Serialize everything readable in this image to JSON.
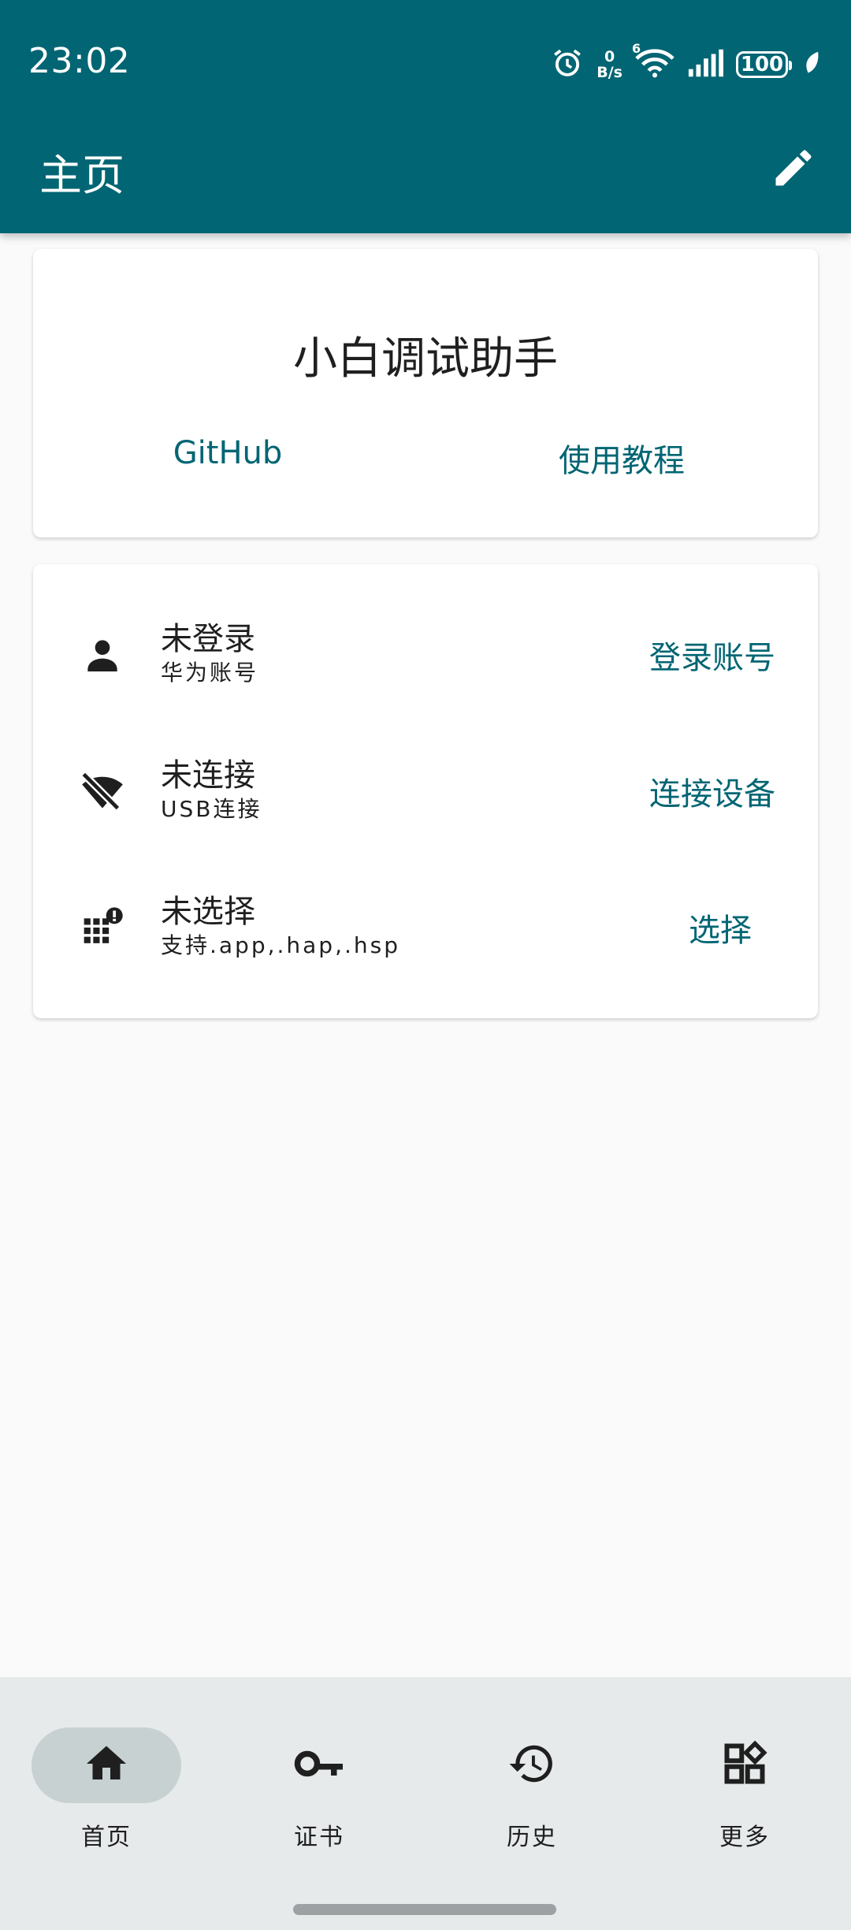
{
  "status_bar": {
    "time": "23:02",
    "net_speed_value": "0",
    "net_speed_unit": "B/s",
    "wifi_label": "6",
    "battery": "100",
    "icons": [
      "alarm-icon",
      "wifi-icon",
      "signal-icon",
      "battery-icon",
      "leaf-icon"
    ]
  },
  "app_bar": {
    "title": "主页",
    "action_icon": "edit-icon"
  },
  "hero_card": {
    "title": "小白调试助手",
    "links": [
      "GitHub",
      "使用教程"
    ]
  },
  "status_card": {
    "rows": [
      {
        "icon": "person-icon",
        "title": "未登录",
        "subtitle": "华为账号",
        "action": "登录账号"
      },
      {
        "icon": "wifi-off-icon",
        "title": "未连接",
        "subtitle": "USB连接",
        "action": "连接设备"
      },
      {
        "icon": "apps-alert-icon",
        "title": "未选择",
        "subtitle": "支持.app,.hap,.hsp",
        "action": "选择"
      }
    ]
  },
  "bottom_nav": {
    "items": [
      {
        "label": "首页",
        "icon": "home-icon",
        "active": true
      },
      {
        "label": "证书",
        "icon": "key-icon",
        "active": false
      },
      {
        "label": "历史",
        "icon": "history-icon",
        "active": false
      },
      {
        "label": "更多",
        "icon": "widgets-icon",
        "active": false
      }
    ]
  },
  "colors": {
    "primary": "#016573",
    "background": "#fafafa",
    "nav_background": "#e7eaeb",
    "active_pill": "#c7d1d2"
  }
}
